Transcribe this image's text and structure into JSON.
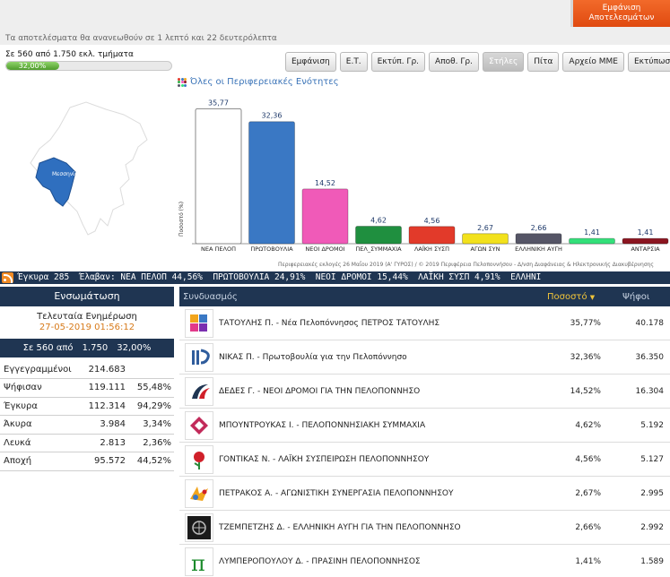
{
  "header": {
    "refresh_note": "Τα αποτελέσματα θα ανανεωθούν σε 1 λεπτό και 22 δευτερόλεπτα",
    "cta_button_line1": "Εμφάνιση",
    "cta_button_line2": "Αποτελεσμάτων"
  },
  "progress": {
    "label": "Σε 560 από 1.750 εκλ. τμήματα",
    "percent_text": "32,00%",
    "fraction": 0.32
  },
  "toolbar": [
    {
      "label": "Εμφάνιση",
      "active": false
    },
    {
      "label": "Ε.Τ.",
      "active": false
    },
    {
      "label": "Εκτύπ. Γρ.",
      "active": false
    },
    {
      "label": "Αποθ. Γρ.",
      "active": false
    },
    {
      "label": "Στήλες",
      "active": true
    },
    {
      "label": "Πίτα",
      "active": false
    },
    {
      "label": "Αρχείο ΜΜΕ",
      "active": false
    },
    {
      "label": "Εκτύπωση",
      "active": false
    }
  ],
  "map": {
    "region_label": "Μεσσηνίας",
    "highlight_color": "#2f6fbf"
  },
  "chart_title": "Όλες οι Περιφερειακές Ενότητες",
  "chart_data": {
    "type": "bar",
    "categories": [
      "ΝΕΑ ΠΕΛΟΠ",
      "ΠΡΩΤΟΒΟΥΛΙΑ",
      "ΝΕΟΙ ΔΡΟΜΟΙ",
      "ΠΕΛ_ΣΥΜΜΑΧΙΑ",
      "ΛΑΪΚΗ ΣΥΣΠ",
      "ΑΓΩΝ ΣΥΝ",
      "ΕΛΛΗΝΙΚΗ ΑΥΓΗ",
      "",
      "ΑΝΤΑΡΣΙΑ"
    ],
    "values": [
      35.77,
      32.36,
      14.52,
      4.62,
      4.56,
      2.67,
      2.66,
      1.41,
      1.41
    ],
    "value_labels": [
      "35,77",
      "32,36",
      "14,52",
      "4,62",
      "4,56",
      "2,67",
      "2,66",
      "1,41",
      "1,41"
    ],
    "colors": [
      "#ffffff",
      "#3a78c4",
      "#f05ab8",
      "#1f8f3f",
      "#e23a2a",
      "#f2e11c",
      "#555566",
      "#33e07a",
      "#8b1520"
    ],
    "ylabel": "Ποσοστό (%)",
    "ylim": [
      0,
      38
    ],
    "grid": false
  },
  "chart_credit": "Περιφερειακές εκλογές 26 Μαΐου 2019 (Α' ΓΥΡΟΣ) / © 2019 Περιφέρεια Πελοποννήσου - Δ/νση Διαφάνειας & Ηλεκτρονικής Διακυβέρνησης",
  "ticker": "Έγκυρα 285  Έλαβαν: ΝΕΑ ΠΕΛΟΠ 44,56%  ΠΡΩΤΟΒΟΥΛΙΑ 24,91%  ΝΕΟΙ ΔΡΟΜΟΙ 15,44%  ΛΑΪΚΗ ΣΥΣΠ 4,91%  ΕΛΛΗΝΙ",
  "stats": {
    "heading": "Ενσωμάτωση",
    "updated_label": "Τελευταία Ενημέρωση",
    "updated_date": "27-05-2019 01:56:12",
    "counted": {
      "a": "Σε 560 από",
      "b": "1.750",
      "c": "32,00%"
    },
    "rows": [
      {
        "label": "Εγγεγραμμένοι",
        "value": "214.683",
        "pct": ""
      },
      {
        "label": "Ψήφισαν",
        "value": "119.111",
        "pct": "55,48%"
      },
      {
        "label": "Έγκυρα",
        "value": "112.314",
        "pct": "94,29%"
      },
      {
        "label": "Άκυρα",
        "value": "3.984",
        "pct": "3,34%"
      },
      {
        "label": "Λευκά",
        "value": "2.813",
        "pct": "2,36%"
      },
      {
        "label": "Αποχή",
        "value": "95.572",
        "pct": "44,52%"
      }
    ]
  },
  "results": {
    "col_coalition": "Συνδυασμός",
    "col_pct": "Ποσοστό",
    "col_votes": "Ψήφοι",
    "rows": [
      {
        "name": "ΤΑΤΟΥΛΗΣ Π. - Νέα Πελοπόννησος ΠΕΤΡΟΣ ΤΑΤΟΥΛΗΣ",
        "pct": "35,77%",
        "votes": "40.178",
        "logo": "nea-peloponnisos-logo"
      },
      {
        "name": "ΝΙΚΑΣ Π. - Πρωτοβουλία για την Πελοπόννησο",
        "pct": "32,36%",
        "votes": "36.350",
        "logo": "protovoulia-logo"
      },
      {
        "name": "ΔΕΔΕΣ Γ. - ΝΕΟΙ ΔΡΟΜΟΙ ΓΙΑ ΤΗΝ ΠΕΛΟΠΟΝΝΗΣΟ",
        "pct": "14,52%",
        "votes": "16.304",
        "logo": "neoi-dromoi-logo"
      },
      {
        "name": "ΜΠΟΥΝΤΡΟΥΚΑΣ Ι. - ΠΕΛΟΠΟΝΝΗΣΙΑΚΗ ΣΥΜΜΑΧΙΑ",
        "pct": "4,62%",
        "votes": "5.192",
        "logo": "symmachia-logo"
      },
      {
        "name": "ΓΟΝΤΙΚΑΣ Ν. - ΛΑΪΚΗ ΣΥΣΠΕΙΡΩΣΗ ΠΕΛΟΠΟΝΝΗΣΟΥ",
        "pct": "4,56%",
        "votes": "5.127",
        "logo": "laiki-syspeirosi-logo"
      },
      {
        "name": "ΠΕΤΡΑΚΟΣ Α. - ΑΓΩΝΙΣΤΙΚΗ ΣΥΝΕΡΓΑΣΙΑ ΠΕΛΟΠΟΝΝΗΣΟΥ",
        "pct": "2,67%",
        "votes": "2.995",
        "logo": "agonistiki-logo"
      },
      {
        "name": "ΤΖΕΜΠΕΤΖΗΣ Δ. - ΕΛΛΗΝΙΚΗ ΑΥΓΗ ΓΙΑ ΤΗΝ ΠΕΛΟΠΟΝΝΗΣΟ",
        "pct": "2,66%",
        "votes": "2.992",
        "logo": "elliniki-avgi-logo"
      },
      {
        "name": "ΛΥΜΠΕΡΟΠΟΥΛΟΥ Δ. - ΠΡΑΣΙΝΗ ΠΕΛΟΠΟΝΝΗΣΟΣ",
        "pct": "1,41%",
        "votes": "1.589",
        "logo": "prasini-logo"
      }
    ]
  }
}
